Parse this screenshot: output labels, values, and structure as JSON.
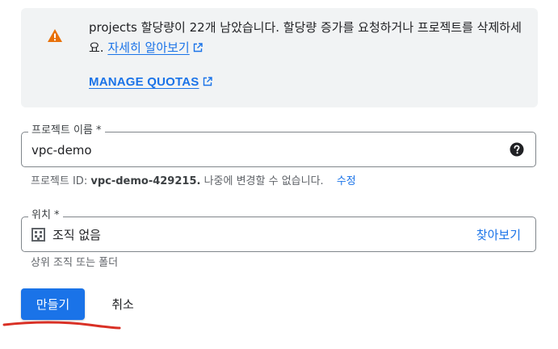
{
  "banner": {
    "message": "projects 할당량이 22개 남았습니다. 할당량 증가를 요청하거나 프로젝트를 삭제하세요.",
    "learn_more": "자세히 알아보기",
    "manage_quotas": "MANAGE QUOTAS",
    "icon": "warning-icon",
    "icon_color": "#e8710a"
  },
  "project_name": {
    "label": "프로젝트 이름 *",
    "value": "vpc-demo",
    "help_icon": "help-icon"
  },
  "project_id": {
    "prefix": "프로젝트 ID:",
    "id": "vpc-demo-429215.",
    "suffix": "나중에 변경할 수 없습니다.",
    "edit": "수정"
  },
  "location": {
    "label": "위치 *",
    "value": "조직 없음",
    "browse": "찾아보기",
    "hint": "상위 조직 또는 폴더",
    "icon": "building-icon"
  },
  "actions": {
    "create": "만들기",
    "cancel": "취소"
  },
  "colors": {
    "accent": "#1a73e8",
    "warning": "#e8710a",
    "annotation": "#d93025"
  }
}
